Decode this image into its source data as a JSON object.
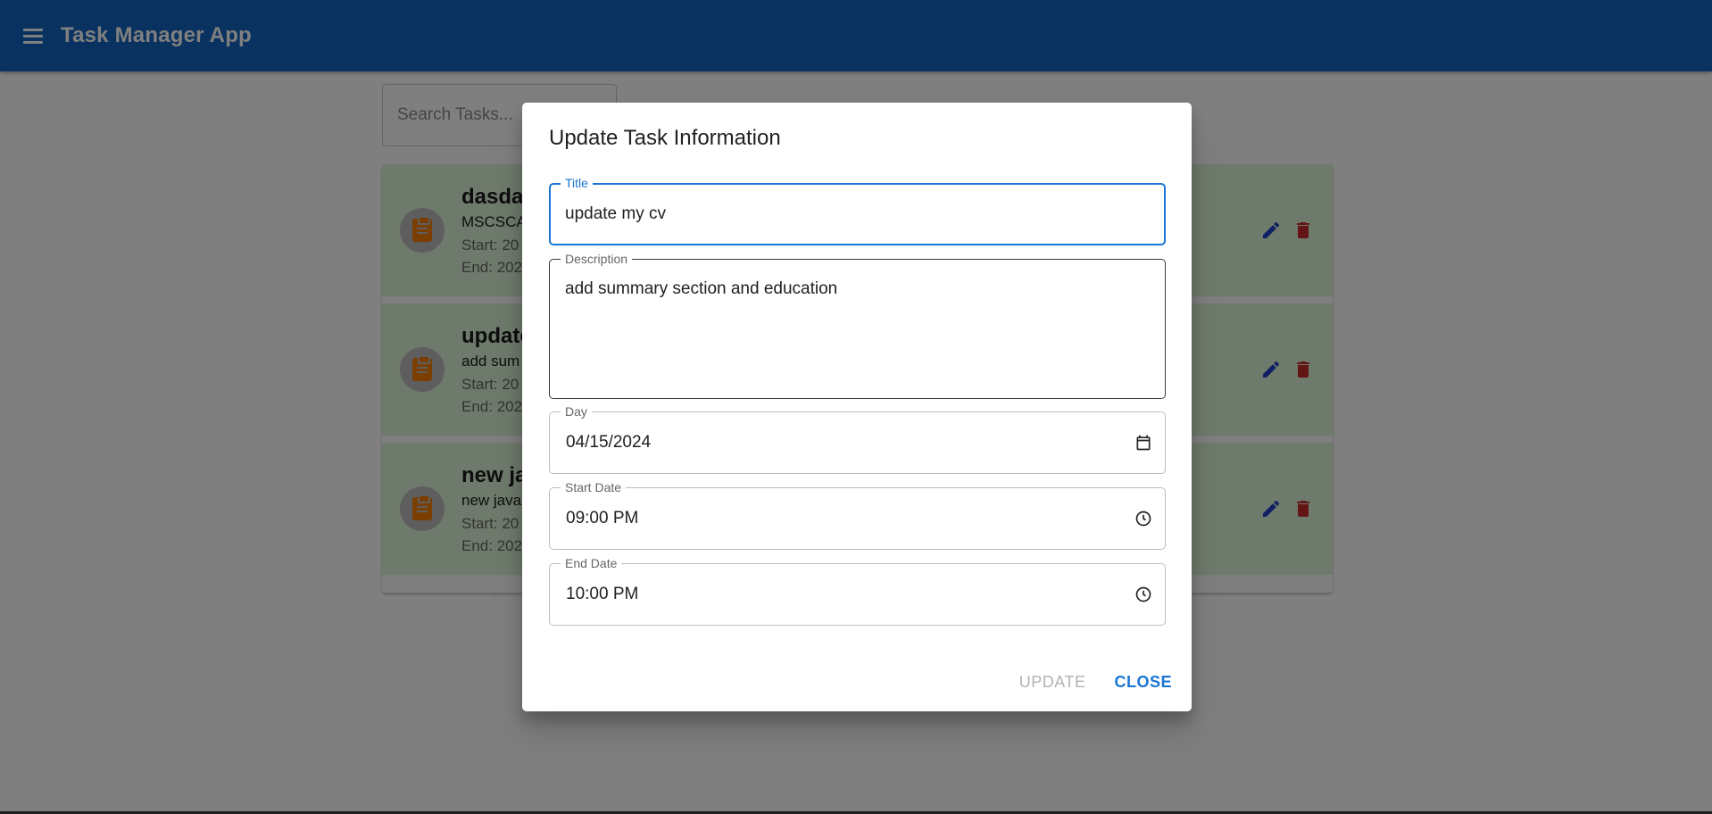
{
  "app": {
    "title": "Task Manager App"
  },
  "search": {
    "placeholder": "Search Tasks..."
  },
  "tasks": [
    {
      "title": "dasda",
      "description": "MSCSCA",
      "start": "Start: 20",
      "end": "End: 202"
    },
    {
      "title": "update",
      "description": "add sum",
      "start": "Start: 20",
      "end": "End: 202"
    },
    {
      "title": "new ja",
      "description": "new java",
      "start": "Start: 20",
      "end": "End: 202"
    }
  ],
  "dialog": {
    "title": "Update Task Information",
    "fields": {
      "title": {
        "label": "Title",
        "value": "update my cv"
      },
      "description": {
        "label": "Description",
        "value": "add summary section and education"
      },
      "day": {
        "label": "Day",
        "value": "04/15/2024"
      },
      "start": {
        "label": "Start Date",
        "value": "09:00 PM"
      },
      "end": {
        "label": "End Date",
        "value": "10:00 PM"
      }
    },
    "actions": {
      "update": "UPDATE",
      "close": "CLOSE"
    }
  },
  "colors": {
    "appbar": "#1565c0",
    "task_bg": "#dcf5d6",
    "accent": "#1976d2",
    "task_icon": "#f57c00",
    "edit_icon": "#1e40c8",
    "delete_icon": "#c62828"
  }
}
